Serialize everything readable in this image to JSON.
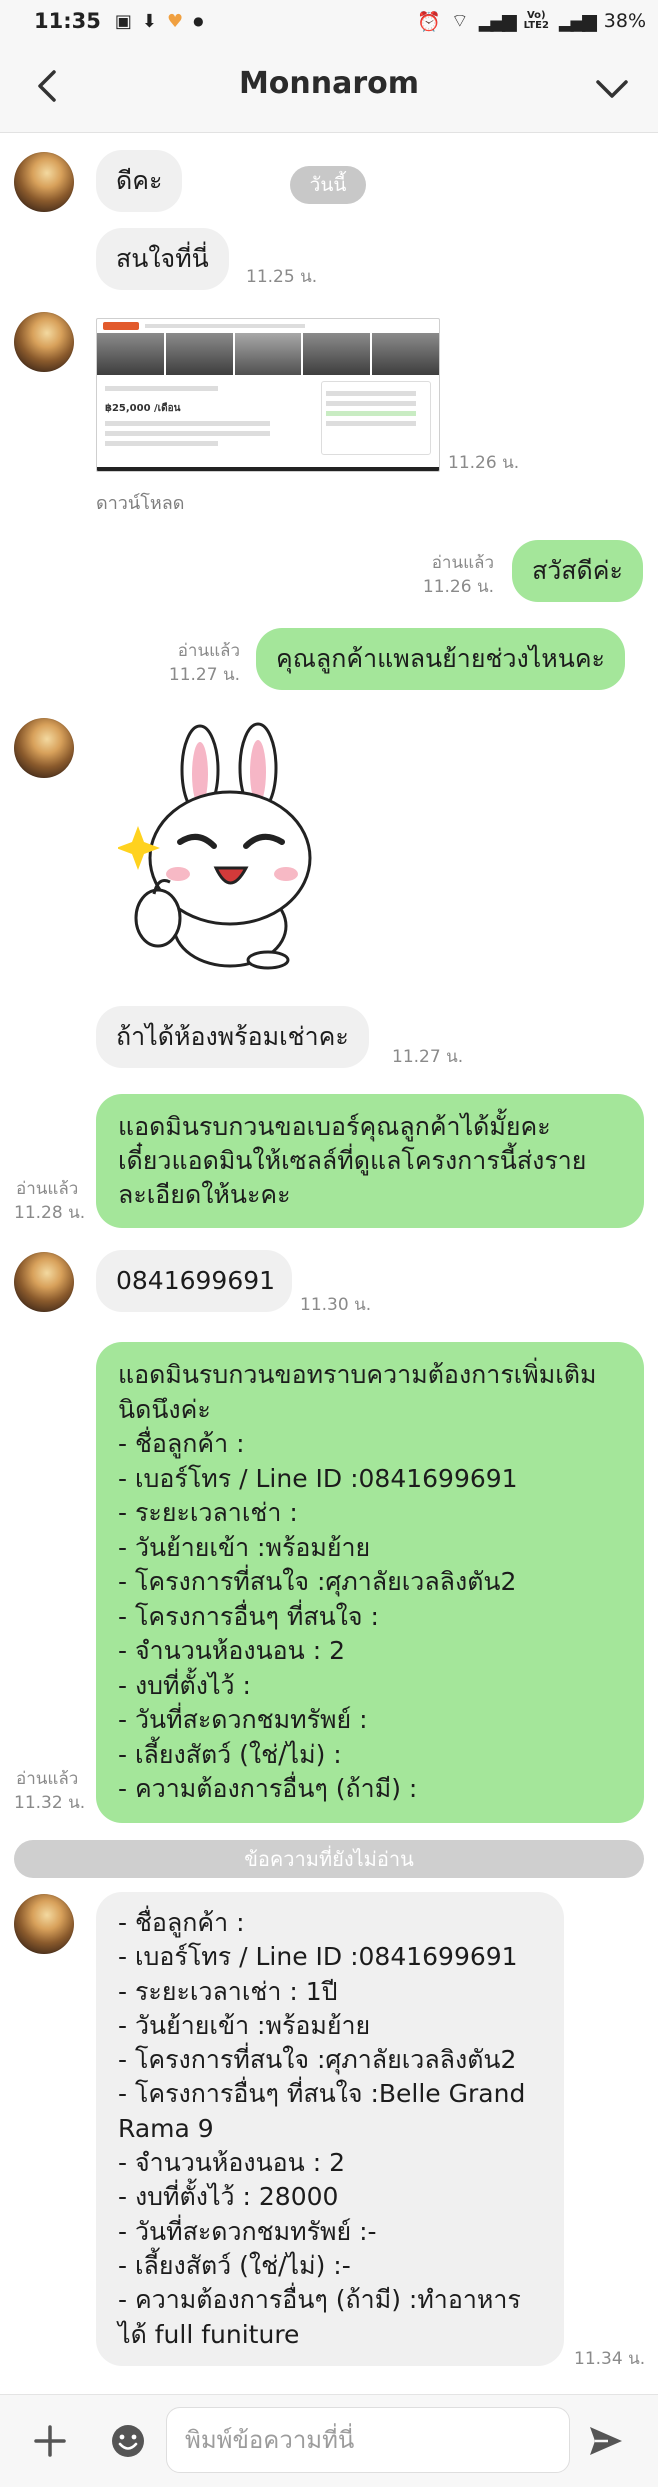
{
  "status_bar": {
    "time": "11:35",
    "battery": "38%",
    "network_top": "Vo)",
    "network_bottom": "LTE2"
  },
  "header": {
    "title": "Monnarom"
  },
  "date_chip": "วันนี้",
  "download_label": "ดาวน์โหลด",
  "unread_divider": "ข้อความที่ยังไม่อ่าน",
  "image_preview": {
    "price": "฿25,000 /เดือน"
  },
  "messages": [
    {
      "text": "ดีคะ"
    },
    {
      "text": "สนใจที่นี่",
      "time": "11.25 น."
    },
    {
      "time": "11.26 น."
    },
    {
      "text": "สวัสดีค่ะ",
      "read": "อ่านแล้ว",
      "time": "11.26 น."
    },
    {
      "text": "คุณลูกค้าแพลนย้ายช่วงไหนคะ",
      "read": "อ่านแล้ว",
      "time": "11.27 น."
    },
    {
      "text": "ถ้าได้ห้องพร้อมเช่าคะ",
      "time": "11.27 น."
    },
    {
      "text": "แอดมินรบกวนขอเบอร์คุณลูกค้าได้มั้ยคะ\nเดี๋ยวแอดมินให้เซลล์ที่ดูแลโครงการนี้ส่งราย\nละเอียดให้นะคะ",
      "read": "อ่านแล้ว",
      "time": "11.28 น."
    },
    {
      "text": "0841699691",
      "time": "11.30 น."
    },
    {
      "text": "แอดมินรบกวนขอทราบความต้องการเพิ่มเติม\nนิดนึงค่ะ\n- ชื่อลูกค้า :\n- เบอร์โทร / Line ID :0841699691\n- ระยะเวลาเช่า :\n- วันย้ายเข้า :พร้อมย้าย\n- โครงการที่สนใจ :ศุภาลัยเวลลิงตัน2\n- โครงการอื่นๆ ที่สนใจ :\n- จำนวนห้องนอน : 2\n- งบที่ตั้งไว้ :\n- วันที่สะดวกชมทรัพย์ :\n- เลี้ยงสัตว์ (ใช่/ไม่) :\n- ความต้องการอื่นๆ (ถ้ามี) :",
      "read": "อ่านแล้ว",
      "time": "11.32 น."
    },
    {
      "text": "- ชื่อลูกค้า :\n- เบอร์โทร / Line ID :0841699691\n- ระยะเวลาเช่า : 1ปี\n- วันย้ายเข้า :พร้อมย้าย\n- โครงการที่สนใจ :ศุภาลัยเวลลิงตัน2\n- โครงการอื่นๆ ที่สนใจ :Belle Grand\nRama 9\n- จำนวนห้องนอน : 2\n- งบที่ตั้งไว้ : 28000\n- วันที่สะดวกชมทรัพย์ :-\n- เลี้ยงสัตว์ (ใช่/ไม่) :-\n- ความต้องการอื่นๆ (ถ้ามี) :ทำอาหาร\nได้ full funiture",
      "time": "11.34 น."
    }
  ],
  "input": {
    "placeholder": "พิมพ์ข้อความที่นี่"
  },
  "colors": {
    "outgoing": "#a4e69a",
    "incoming": "#f0f0f0",
    "header": "#f7f7f7"
  }
}
